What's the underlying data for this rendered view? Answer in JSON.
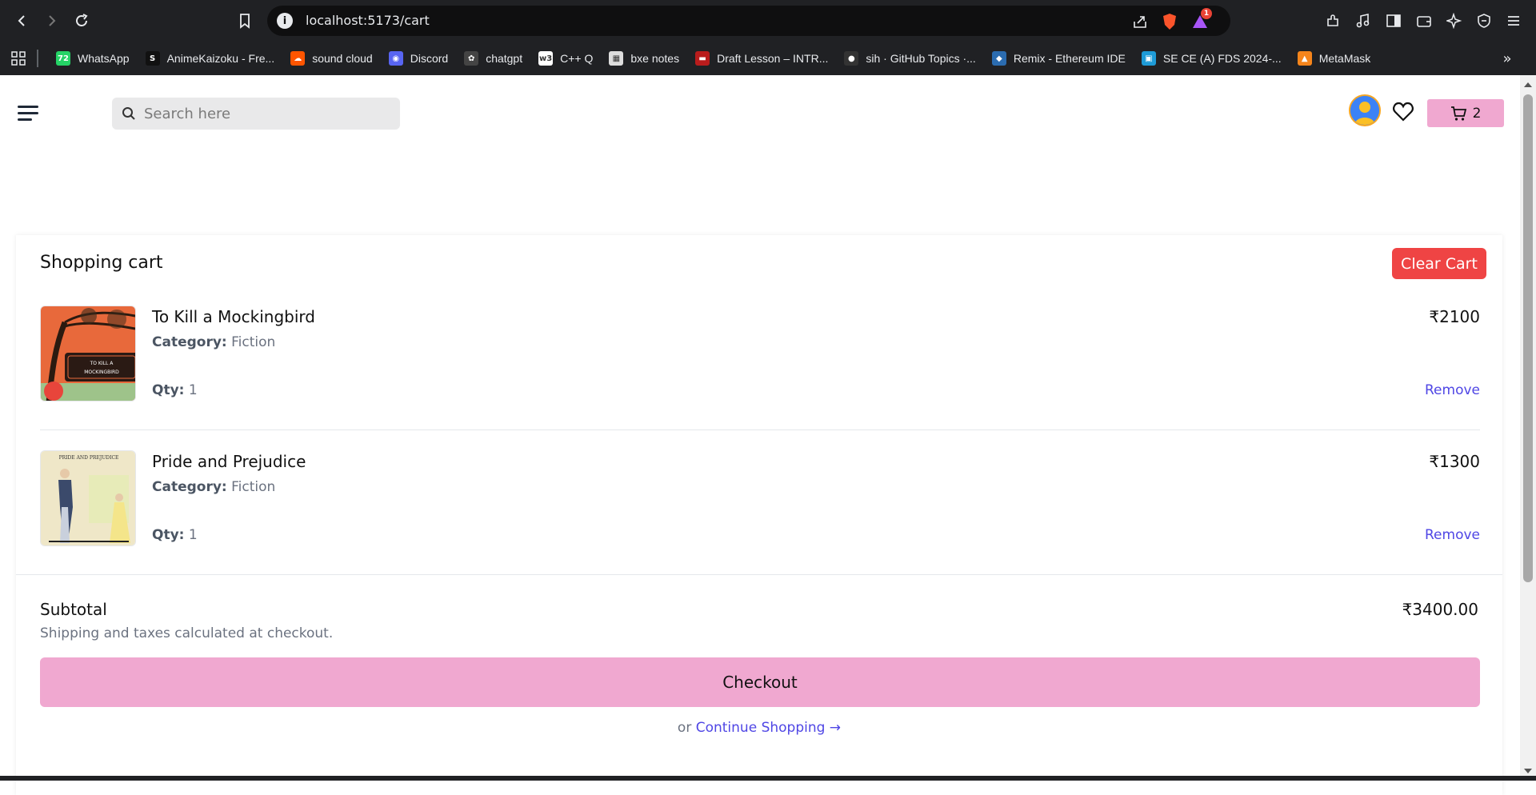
{
  "browser": {
    "url": "localhost:5173/cart",
    "bookmarks": [
      {
        "label": "WhatsApp",
        "icon": "whatsapp-icon",
        "color": "#25d366",
        "glyph": "72"
      },
      {
        "label": "AnimeKaizoku - Fre...",
        "icon": "animekaizoku-icon",
        "color": "#111111",
        "glyph": "S"
      },
      {
        "label": "sound cloud",
        "icon": "soundcloud-icon",
        "color": "#ff5500",
        "glyph": "☁"
      },
      {
        "label": "Discord",
        "icon": "discord-icon",
        "color": "#5865f2",
        "glyph": "◉"
      },
      {
        "label": "chatgpt",
        "icon": "chatgpt-icon",
        "color": "#444444",
        "glyph": "✿"
      },
      {
        "label": "C++ Q",
        "icon": "w3schools-icon",
        "color": "#ffffff",
        "glyph": "w3"
      },
      {
        "label": "bxe notes",
        "icon": "notes-icon",
        "color": "#dddddd",
        "glyph": "▦"
      },
      {
        "label": "Draft Lesson – INTR...",
        "icon": "draft-lesson-icon",
        "color": "#b91c1c",
        "glyph": "▬"
      },
      {
        "label": "sih · GitHub Topics ·...",
        "icon": "github-icon",
        "color": "#333333",
        "glyph": "●"
      },
      {
        "label": "Remix - Ethereum IDE",
        "icon": "remix-icon",
        "color": "#2b6cb0",
        "glyph": "◆"
      },
      {
        "label": "SE CE (A) FDS 2024-...",
        "icon": "classroom-icon",
        "color": "#1e9bd7",
        "glyph": "▣"
      },
      {
        "label": "MetaMask",
        "icon": "metamask-icon",
        "color": "#f6851b",
        "glyph": "▲"
      }
    ],
    "notification_count": "1"
  },
  "header": {
    "search_placeholder": "Search here",
    "cart_count": "2"
  },
  "cart": {
    "title": "Shopping cart",
    "clear_label": "Clear Cart",
    "category_label": "Category:",
    "qty_label": "Qty:",
    "remove_label": "Remove",
    "items": [
      {
        "name": "To Kill a Mockingbird",
        "category": "Fiction",
        "qty": "1",
        "price": "₹2100"
      },
      {
        "name": "Pride and Prejudice",
        "category": "Fiction",
        "qty": "1",
        "price": "₹1300"
      }
    ],
    "subtotal_label": "Subtotal",
    "subtotal_value": "₹3400.00",
    "shipping_note": "Shipping and taxes calculated at checkout.",
    "checkout_label": "Checkout",
    "or_text": "or",
    "continue_label": "Continue Shopping →"
  },
  "colors": {
    "accent_pink": "#f0a8d0",
    "danger": "#ef4444",
    "link": "#4f46e5"
  }
}
